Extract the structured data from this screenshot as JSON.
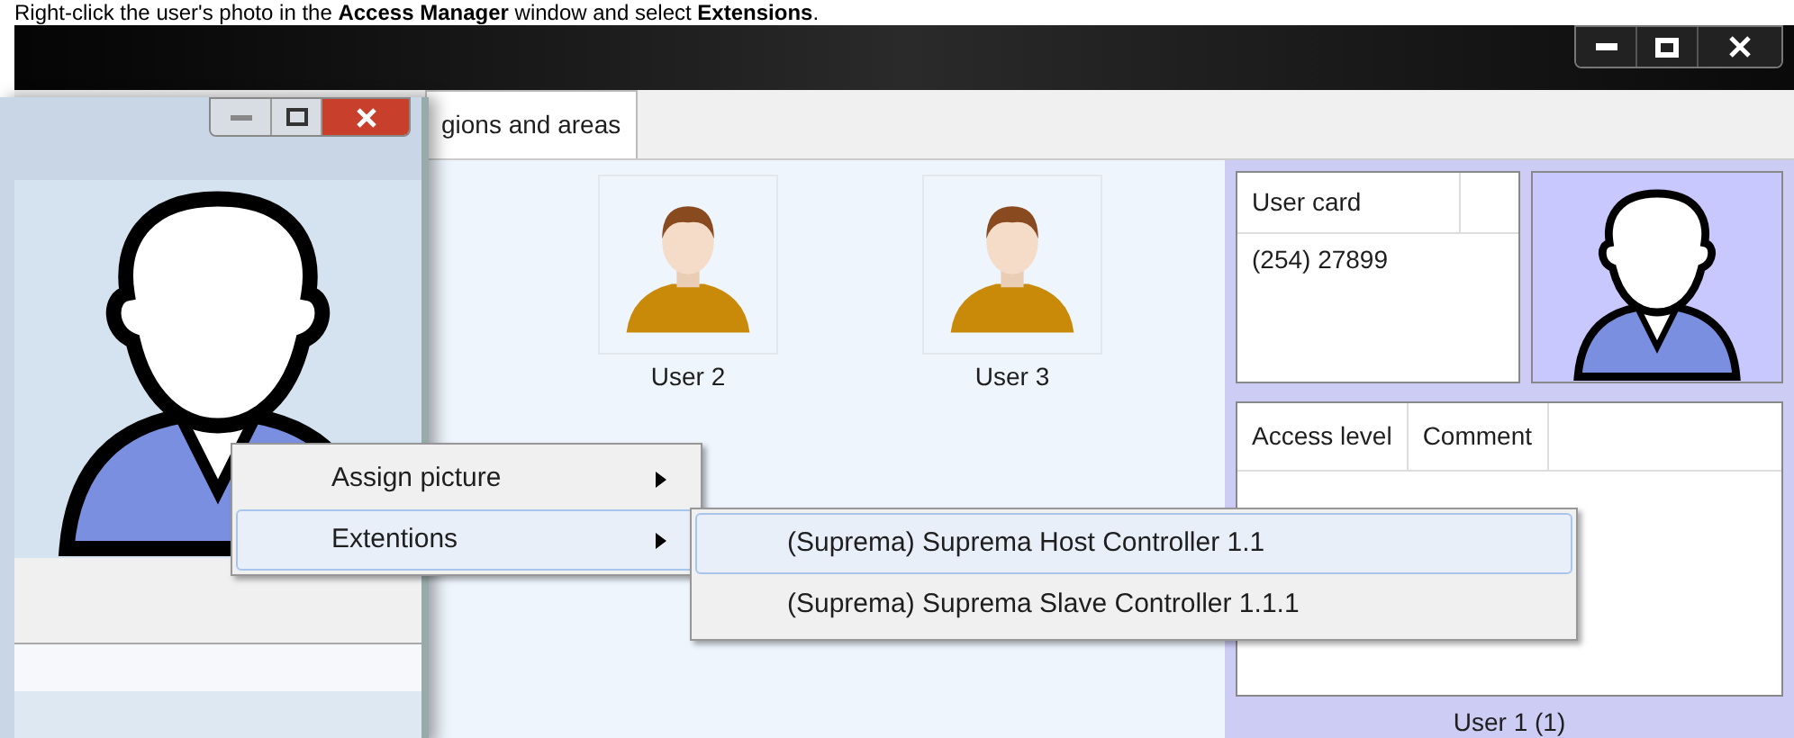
{
  "instruction": "Right-click the user's photo in the **Access Manager** window and select **Extensions**.",
  "main_window": {
    "tabs": [
      {
        "label": "gions and areas",
        "selected": true
      }
    ],
    "users": [
      {
        "name": "User 2"
      },
      {
        "name": "User 3"
      }
    ],
    "user_card_table": {
      "columns": [
        "User card"
      ],
      "rows": [
        [
          "(254) 27899"
        ]
      ]
    },
    "access_table": {
      "columns": [
        "Access level",
        "Comment"
      ]
    },
    "selected_user": "User 1 (1)"
  },
  "context_menu": {
    "items": [
      {
        "label": "Assign picture",
        "selected": false,
        "has_submenu": true
      },
      {
        "label": "Extentions",
        "selected": true,
        "has_submenu": true
      }
    ]
  },
  "submenu": {
    "items": [
      {
        "label": "(Suprema) Suprema Host Controller 1.1",
        "selected": true
      },
      {
        "label": "(Suprema) Suprema Slave Controller 1.1.1",
        "selected": false
      }
    ]
  }
}
